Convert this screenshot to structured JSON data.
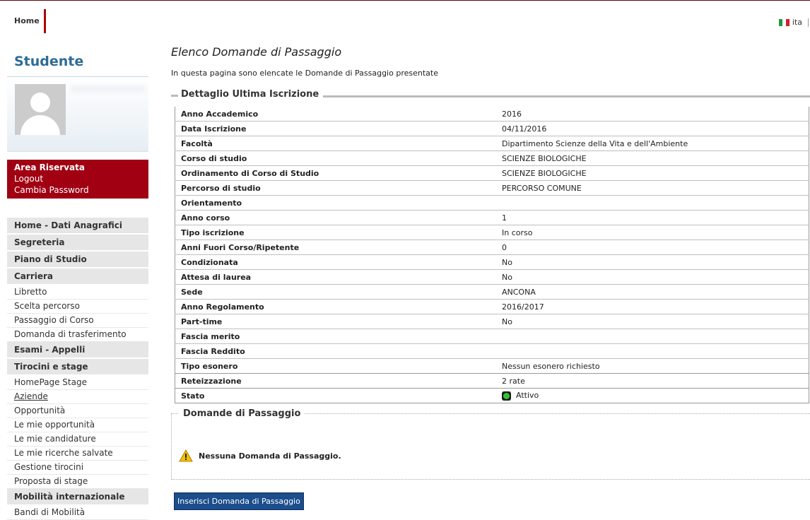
{
  "topbar": {
    "home_label": "Home",
    "lang_label": "ita"
  },
  "sidebar": {
    "title": "Studente",
    "area": {
      "title": "Area Riservata",
      "logout": "Logout",
      "change_password": "Cambia Password"
    },
    "nav": [
      {
        "type": "h",
        "label": "Home - Dati Anagrafici"
      },
      {
        "type": "h",
        "label": "Segreteria"
      },
      {
        "type": "h",
        "label": "Piano di Studio"
      },
      {
        "type": "h",
        "label": "Carriera"
      },
      {
        "type": "i",
        "label": "Libretto"
      },
      {
        "type": "i",
        "label": "Scelta percorso"
      },
      {
        "type": "i",
        "label": "Passaggio di Corso"
      },
      {
        "type": "i",
        "label": "Domanda di trasferimento"
      },
      {
        "type": "h",
        "label": "Esami - Appelli"
      },
      {
        "type": "h",
        "label": "Tirocini e stage"
      },
      {
        "type": "i",
        "label": "HomePage Stage"
      },
      {
        "type": "i",
        "label": "Aziende",
        "underline": true
      },
      {
        "type": "i",
        "label": "Opportunità"
      },
      {
        "type": "i",
        "label": "Le mie opportunità"
      },
      {
        "type": "i",
        "label": "Le mie candidature"
      },
      {
        "type": "i",
        "label": "Le mie ricerche salvate"
      },
      {
        "type": "i",
        "label": "Gestione tirocini"
      },
      {
        "type": "i",
        "label": "Proposta di stage"
      },
      {
        "type": "h",
        "label": "Mobilità internazionale"
      },
      {
        "type": "i",
        "label": "Bandi di Mobilità"
      }
    ]
  },
  "main": {
    "title": "Elenco Domande di Passaggio",
    "intro": "In questa pagina sono elencate le Domande di Passaggio presentate",
    "section_title": "Dettaglio Ultima Iscrizione",
    "rows": [
      [
        "Anno Accademico",
        "2016"
      ],
      [
        "Data Iscrizione",
        "04/11/2016"
      ],
      [
        "Facoltà",
        "Dipartimento Scienze della Vita e dell'Ambiente"
      ],
      [
        "Corso di studio",
        "SCIENZE BIOLOGICHE"
      ],
      [
        "Ordinamento di Corso di Studio",
        "SCIENZE BIOLOGICHE"
      ],
      [
        "Percorso di studio",
        "PERCORSO COMUNE"
      ],
      [
        "Orientamento",
        ""
      ],
      [
        "Anno corso",
        "1"
      ],
      [
        "Tipo iscrizione",
        "In corso"
      ],
      [
        "Anni Fuori Corso/Ripetente",
        "0"
      ],
      [
        "Condizionata",
        "No"
      ],
      [
        "Attesa di laurea",
        "No"
      ],
      [
        "Sede",
        "ANCONA"
      ],
      [
        "Anno Regolamento",
        "2016/2017"
      ],
      [
        "Part-time",
        "No"
      ],
      [
        "Fascia merito",
        ""
      ],
      [
        "Fascia Reddito",
        ""
      ],
      [
        "Tipo esonero",
        "Nessun esonero richiesto"
      ],
      [
        "Reteizzazione",
        "2 rate"
      ]
    ],
    "status_label": "Stato",
    "status_value": "Attivo",
    "domande_title": "Domande di Passaggio",
    "no_domande": "Nessuna Domanda di Passaggio.",
    "insert_button": "Inserisci Domanda di Passaggio"
  }
}
